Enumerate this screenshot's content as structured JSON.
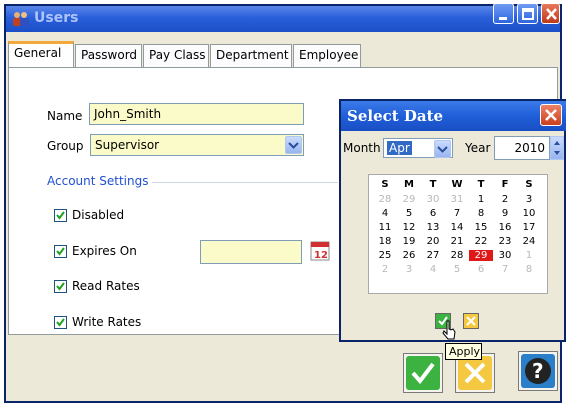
{
  "window": {
    "title": "Users"
  },
  "tabs": [
    {
      "label": "General",
      "active": true
    },
    {
      "label": "Password"
    },
    {
      "label": "Pay Class"
    },
    {
      "label": "Department"
    },
    {
      "label": "Employee"
    }
  ],
  "general": {
    "name_label": "Name",
    "name_value": "John_Smith",
    "group_label": "Group",
    "group_value": "Supervisor",
    "account_settings_label": "Account Settings",
    "checkboxes": [
      {
        "label": "Disabled",
        "checked": true
      },
      {
        "label": "Expires On",
        "checked": true
      },
      {
        "label": "Read Rates",
        "checked": true
      },
      {
        "label": "Write Rates",
        "checked": true
      }
    ],
    "expires_value": ""
  },
  "date_dialog": {
    "title": "Select Date",
    "month_label": "Month",
    "month_value": "Apr",
    "year_label": "Year",
    "year_value": "2010",
    "weekday_headers": [
      "S",
      "M",
      "T",
      "W",
      "T",
      "F",
      "S"
    ],
    "weeks": [
      [
        "28",
        "29",
        "30",
        "31",
        "1",
        "2",
        "3"
      ],
      [
        "4",
        "5",
        "6",
        "7",
        "8",
        "9",
        "10"
      ],
      [
        "11",
        "12",
        "13",
        "14",
        "15",
        "16",
        "17"
      ],
      [
        "18",
        "19",
        "20",
        "21",
        "22",
        "23",
        "24"
      ],
      [
        "25",
        "26",
        "27",
        "28",
        "29",
        "30",
        "1"
      ],
      [
        "2",
        "3",
        "4",
        "5",
        "6",
        "7",
        "8"
      ]
    ],
    "selected_day": "29",
    "tooltip": "Apply"
  },
  "colors": {
    "accent": "#2150d0",
    "field_bg": "#fbfbc9",
    "titlebar": "#2a5fdb",
    "today": "#e01818"
  },
  "icons": [
    "users-icon",
    "minimize-icon",
    "maximize-icon",
    "close-icon",
    "calendar-icon",
    "dropdown-arrow-icon",
    "checkmark-icon",
    "cancel-icon",
    "help-icon",
    "mouse-cursor-icon"
  ]
}
